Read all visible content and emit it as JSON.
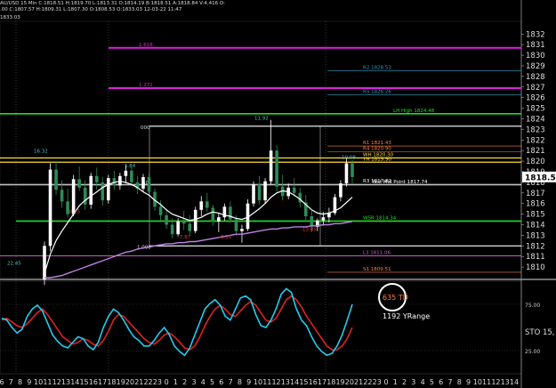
{
  "header": {
    "line1": "AU/USD 15 Min C:1818.51 H:1819.70 L:1813.31 O:1814.19 B:1818.51 A:1818.84 V:4,416 O:",
    "line2": ".00 C:1807.57 H:1809.31 L:1807.30 O:1808.53 O:1833.03 12-03-22 11:47",
    "line3": "1833.03"
  },
  "colors": {
    "background": "#000000",
    "price_up": "#ffffff",
    "price_down": "#2e8b57",
    "fib_magenta": "#e020e0",
    "support_green": "#22dd22",
    "ma_white": "#ffffff",
    "ma_magenta": "#c080e0",
    "sto_k": "#22ccee",
    "sto_d": "#dd2222",
    "accent_orange": "#ff8040"
  },
  "chart_data": {
    "type": "candlestick",
    "price_axis": {
      "ylim": [
        1809.0,
        1833.2
      ],
      "ticks": [
        1810,
        1811,
        1812,
        1813,
        1814,
        1815,
        1816,
        1817,
        1818,
        1819,
        1820,
        1821,
        1822,
        1823,
        1824,
        1825,
        1826,
        1827,
        1828,
        1829,
        1830,
        1831,
        1832
      ],
      "last_price": "1818.51"
    },
    "time_axis": {
      "labels": [
        "6",
        "7",
        "8",
        "9",
        "10",
        "11",
        "12",
        "13",
        "14",
        "15",
        "16",
        "17",
        "18",
        "19",
        "20",
        "21",
        "22",
        "23",
        "0",
        "1",
        "2",
        "3",
        "4",
        "5",
        "6",
        "7",
        "8",
        "9",
        "10",
        "11",
        "12",
        "13",
        "14",
        "15",
        "16",
        "17",
        "18",
        "19",
        "20",
        "21",
        "22",
        "23",
        "0",
        "1",
        "2",
        "3",
        "4",
        "5",
        "6",
        "7",
        "8",
        "9",
        "10",
        "11",
        "12",
        "13",
        "14"
      ]
    },
    "horizontal_levels": [
      {
        "label": "R2 1828.53",
        "price": 1828.53,
        "color": "#20a0c0"
      },
      {
        "label": "R5 1826.26",
        "price": 1826.26,
        "color": "#20a0c0"
      },
      {
        "label": "LH High 1824.48",
        "price": 1824.48,
        "color": "#22dd22"
      },
      {
        "label": "R1 1821.43",
        "price": 1821.43,
        "color": "#ff8040"
      },
      {
        "label": "R4 1820.90",
        "price": 1820.9,
        "color": "#ff8040"
      },
      {
        "label": "WH 1820.30",
        "price": 1820.3,
        "color": "#ffdd33"
      },
      {
        "label": "YH 1819.90",
        "price": 1819.9,
        "color": "#ffdd33"
      },
      {
        "label": "R3 1817.82",
        "price": 1817.82,
        "color": "#ffffff"
      },
      {
        "label": "Yest Mid Point 1817.74",
        "price": 1817.74,
        "color": "#ffffff"
      },
      {
        "label": "WSR 1814.34",
        "price": 1814.34,
        "color": "#22dd22"
      },
      {
        "label": "L3 1811.06",
        "price": 1811.06,
        "color": "#c060c0"
      },
      {
        "label": "S1 1809.51",
        "price": 1809.51,
        "color": "#ff8040"
      }
    ],
    "fib_levels": [
      {
        "label": "1.618",
        "price": 1830.7
      },
      {
        "label": "1.272",
        "price": 1826.9
      }
    ],
    "fib_box": {
      "top_label": "000",
      "bottom_label": "1.000",
      "mid_label": "50"
    },
    "swing_labels": [
      {
        "text": "16.32",
        "price": 1820.8
      },
      {
        "text": "11.92",
        "price": 1823.9
      },
      {
        "text": "-8.35",
        "price": 1815.1
      },
      {
        "text": "-7.87",
        "price": 1812.7
      },
      {
        "text": "-8.10",
        "price": 1812.7
      },
      {
        "text": "-13.85",
        "price": 1813.4
      },
      {
        "text": "22.45",
        "price": 1810.2
      },
      {
        "text": "10.08",
        "price": 1820.2
      },
      {
        "text": "5.84",
        "price": 1819.4
      }
    ],
    "candles": [
      [
        1808.8,
        1812.4,
        1808.3,
        1812.0
      ],
      [
        1812.0,
        1819.8,
        1811.5,
        1819.2
      ],
      [
        1819.2,
        1820.0,
        1816.8,
        1817.3
      ],
      [
        1817.3,
        1818.2,
        1815.6,
        1816.2
      ],
      [
        1816.2,
        1817.4,
        1814.7,
        1815.0
      ],
      [
        1815.0,
        1818.7,
        1814.8,
        1818.3
      ],
      [
        1818.3,
        1819.5,
        1817.2,
        1817.5
      ],
      [
        1817.5,
        1818.2,
        1815.4,
        1815.9
      ],
      [
        1815.9,
        1818.9,
        1815.5,
        1818.6
      ],
      [
        1818.6,
        1819.4,
        1817.3,
        1818.0
      ],
      [
        1818.0,
        1818.5,
        1815.8,
        1816.3
      ],
      [
        1816.3,
        1818.7,
        1816.0,
        1818.4
      ],
      [
        1818.4,
        1819.1,
        1817.3,
        1817.7
      ],
      [
        1817.7,
        1818.9,
        1817.3,
        1818.6
      ],
      [
        1818.6,
        1819.6,
        1817.9,
        1819.1
      ],
      [
        1819.1,
        1819.5,
        1817.6,
        1818.0
      ],
      [
        1818.0,
        1818.6,
        1816.9,
        1817.4
      ],
      [
        1817.4,
        1818.8,
        1817.1,
        1818.5
      ],
      [
        1818.5,
        1818.9,
        1816.7,
        1817.1
      ],
      [
        1817.1,
        1817.4,
        1815.3,
        1815.7
      ],
      [
        1815.7,
        1816.3,
        1814.4,
        1814.9
      ],
      [
        1814.9,
        1815.4,
        1813.6,
        1814.0
      ],
      [
        1814.0,
        1814.6,
        1812.7,
        1813.1
      ],
      [
        1813.1,
        1814.6,
        1812.9,
        1814.3
      ],
      [
        1814.3,
        1815.3,
        1813.5,
        1814.1
      ],
      [
        1814.1,
        1814.9,
        1813.0,
        1813.4
      ],
      [
        1813.4,
        1815.7,
        1813.2,
        1815.4
      ],
      [
        1815.4,
        1816.7,
        1814.8,
        1816.2
      ],
      [
        1816.2,
        1817.0,
        1815.2,
        1815.6
      ],
      [
        1815.6,
        1815.9,
        1813.9,
        1814.3
      ],
      [
        1814.3,
        1815.1,
        1813.3,
        1814.7
      ],
      [
        1814.7,
        1816.0,
        1814.4,
        1815.7
      ],
      [
        1815.7,
        1816.2,
        1814.2,
        1814.5
      ],
      [
        1814.5,
        1814.9,
        1813.0,
        1813.4
      ],
      [
        1813.4,
        1814.0,
        1812.3,
        1813.6
      ],
      [
        1813.6,
        1816.4,
        1813.4,
        1816.0
      ],
      [
        1816.0,
        1818.1,
        1815.7,
        1817.8
      ],
      [
        1817.8,
        1818.6,
        1815.9,
        1816.3
      ],
      [
        1816.3,
        1818.4,
        1816.0,
        1818.1
      ],
      [
        1818.1,
        1823.9,
        1817.8,
        1821.0
      ],
      [
        1821.0,
        1821.5,
        1817.1,
        1817.6
      ],
      [
        1817.6,
        1818.7,
        1816.3,
        1816.7
      ],
      [
        1816.7,
        1817.9,
        1816.4,
        1817.5
      ],
      [
        1817.5,
        1818.4,
        1816.6,
        1817.0
      ],
      [
        1817.0,
        1817.5,
        1815.6,
        1816.1
      ],
      [
        1816.1,
        1816.8,
        1814.3,
        1814.8
      ],
      [
        1814.8,
        1815.3,
        1813.3,
        1813.8
      ],
      [
        1813.8,
        1814.6,
        1813.4,
        1814.4
      ],
      [
        1814.4,
        1815.2,
        1813.9,
        1814.7
      ],
      [
        1814.7,
        1815.6,
        1814.2,
        1815.1
      ],
      [
        1815.1,
        1816.9,
        1814.9,
        1816.6
      ],
      [
        1816.6,
        1818.2,
        1816.2,
        1817.9
      ],
      [
        1817.9,
        1820.3,
        1817.6,
        1819.8
      ],
      [
        1819.8,
        1820.1,
        1817.9,
        1818.5
      ]
    ],
    "ma_white": [
      1809.4,
      1811.2,
      1812.5,
      1813.4,
      1814.2,
      1815.0,
      1815.8,
      1816.3,
      1816.7,
      1817.1,
      1817.5,
      1817.8,
      1818.0,
      1818.1,
      1818.0,
      1817.8,
      1817.5,
      1817.1,
      1816.8,
      1816.3,
      1815.9,
      1815.4,
      1815.0,
      1814.8,
      1814.6,
      1814.4,
      1814.5,
      1814.7,
      1815.0,
      1815.2,
      1815.1,
      1814.9,
      1814.8,
      1814.6,
      1814.5,
      1814.7,
      1815.1,
      1815.5,
      1816.0,
      1816.6,
      1817.0,
      1817.2,
      1817.1,
      1816.8,
      1816.4,
      1815.9,
      1815.4,
      1815.1,
      1815.0,
      1815.1,
      1815.3,
      1815.6,
      1816.1,
      1816.6
    ],
    "ma_magenta": [
      1809.0,
      1809.0,
      1809.1,
      1809.2,
      1809.4,
      1809.6,
      1809.8,
      1810.0,
      1810.2,
      1810.4,
      1810.6,
      1810.8,
      1811.0,
      1811.2,
      1811.4,
      1811.5,
      1811.7,
      1811.8,
      1811.9,
      1812.0,
      1812.1,
      1812.2,
      1812.2,
      1812.3,
      1812.3,
      1812.4,
      1812.4,
      1812.5,
      1812.6,
      1812.7,
      1812.8,
      1812.9,
      1813.0,
      1813.1,
      1813.1,
      1813.2,
      1813.3,
      1813.4,
      1813.5,
      1813.6,
      1813.6,
      1813.7,
      1813.7,
      1813.8,
      1813.8,
      1813.8,
      1813.9,
      1813.9,
      1814.0,
      1814.0,
      1814.1,
      1814.1,
      1814.2,
      1814.3
    ],
    "oscillator": {
      "label": "STO 15,",
      "ylim": [
        0,
        100
      ],
      "ticks": [
        25,
        75
      ],
      "k": [
        60,
        58,
        50,
        44,
        48,
        62,
        70,
        74,
        68,
        55,
        42,
        35,
        30,
        28,
        34,
        40,
        38,
        30,
        26,
        34,
        50,
        62,
        70,
        66,
        58,
        48,
        40,
        36,
        30,
        30,
        36,
        44,
        50,
        42,
        30,
        24,
        20,
        28,
        42,
        56,
        70,
        76,
        80,
        74,
        62,
        58,
        70,
        82,
        84,
        80,
        64,
        52,
        50,
        58,
        70,
        86,
        92,
        88,
        70,
        58,
        52,
        40,
        30,
        24,
        20,
        22,
        30,
        42,
        58,
        75
      ],
      "d": [
        58,
        60,
        56,
        52,
        50,
        54,
        60,
        66,
        70,
        64,
        56,
        48,
        40,
        36,
        32,
        34,
        38,
        36,
        32,
        30,
        36,
        46,
        58,
        64,
        62,
        56,
        50,
        44,
        38,
        34,
        32,
        36,
        42,
        44,
        40,
        34,
        28,
        26,
        30,
        40,
        52,
        62,
        70,
        74,
        70,
        64,
        62,
        68,
        74,
        78,
        74,
        66,
        58,
        56,
        60,
        70,
        80,
        84,
        80,
        72,
        62,
        54,
        46,
        38,
        30,
        26,
        26,
        30,
        38,
        50
      ],
      "annotations": [
        {
          "text": "635 TD",
          "color": "#ff8040"
        },
        {
          "text": "1192 YRange",
          "color": "#ffffff"
        }
      ]
    }
  }
}
